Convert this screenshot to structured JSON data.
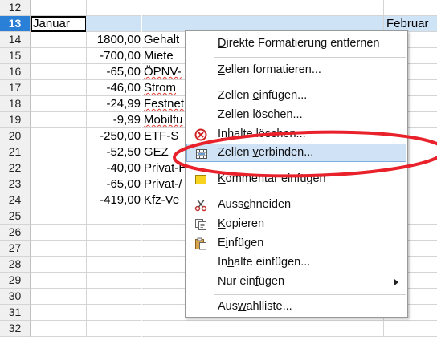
{
  "sheet": {
    "rows": [
      {
        "num": "12",
        "a": "",
        "b": "",
        "c": "",
        "d": ""
      },
      {
        "num": "13",
        "a": "Januar",
        "b": "",
        "c": "",
        "d": "Februar"
      },
      {
        "num": "14",
        "a": "",
        "b": "1800,00",
        "c": "Gehalt",
        "d": ""
      },
      {
        "num": "15",
        "a": "",
        "b": "-700,00",
        "c": "Miete",
        "d": ""
      },
      {
        "num": "16",
        "a": "",
        "b": "-65,00",
        "c": "ÖPNV-",
        "d": ""
      },
      {
        "num": "17",
        "a": "",
        "b": "-46,00",
        "c": "Strom",
        "d": ""
      },
      {
        "num": "18",
        "a": "",
        "b": "-24,99",
        "c": "Festnet",
        "d": ""
      },
      {
        "num": "19",
        "a": "",
        "b": "-9,99",
        "c": "Mobilfu",
        "d": ""
      },
      {
        "num": "20",
        "a": "",
        "b": "-250,00",
        "c": "ETF-S",
        "d": ""
      },
      {
        "num": "21",
        "a": "",
        "b": "-52,50",
        "c": "GEZ",
        "d": ""
      },
      {
        "num": "22",
        "a": "",
        "b": "-40,00",
        "c": "Privat-H",
        "d": ""
      },
      {
        "num": "23",
        "a": "",
        "b": "-65,00",
        "c": "Privat-/",
        "d": ""
      },
      {
        "num": "24",
        "a": "",
        "b": "-419,00",
        "c": "Kfz-Ve",
        "d": ""
      },
      {
        "num": "25",
        "a": "",
        "b": "",
        "c": "",
        "d": ""
      },
      {
        "num": "26",
        "a": "",
        "b": "",
        "c": "",
        "d": ""
      },
      {
        "num": "27",
        "a": "",
        "b": "",
        "c": "",
        "d": ""
      },
      {
        "num": "28",
        "a": "",
        "b": "",
        "c": "",
        "d": ""
      },
      {
        "num": "29",
        "a": "",
        "b": "",
        "c": "",
        "d": ""
      },
      {
        "num": "30",
        "a": "",
        "b": "",
        "c": "",
        "d": ""
      },
      {
        "num": "31",
        "a": "",
        "b": "",
        "c": "",
        "d": ""
      },
      {
        "num": "32",
        "a": "",
        "b": "",
        "c": "",
        "d": ""
      }
    ],
    "selected_row": "13"
  },
  "menu": {
    "remove_formatting": {
      "pre": "",
      "acc": "D",
      "post": "irekte Formatierung entfernen"
    },
    "format_cells": {
      "pre": "",
      "acc": "Z",
      "post": "ellen formatieren..."
    },
    "insert_cells": {
      "pre": "Zellen ",
      "acc": "e",
      "post": "infügen..."
    },
    "delete_cells": {
      "pre": "Zellen ",
      "acc": "l",
      "post": "öschen..."
    },
    "delete_contents": {
      "pre": "I",
      "acc": "n",
      "post": "halte löschen..."
    },
    "merge_cells": {
      "pre": "Zellen ",
      "acc": "v",
      "post": "erbinden..."
    },
    "insert_comment": {
      "pre": "",
      "acc": "K",
      "post": "ommentar einfügen"
    },
    "cut": {
      "pre": "Auss",
      "acc": "c",
      "post": "hneiden"
    },
    "copy": {
      "pre": "",
      "acc": "K",
      "post": "opieren"
    },
    "paste": {
      "pre": "E",
      "acc": "i",
      "post": "nfügen"
    },
    "paste_special": {
      "pre": "In",
      "acc": "h",
      "post": "alte einfügen..."
    },
    "paste_only": {
      "pre": "Nur ein",
      "acc": "f",
      "post": "ügen"
    },
    "selection_list": {
      "pre": "Aus",
      "acc": "w",
      "post": "ahlliste..."
    }
  },
  "icons": {
    "delete_contents": "clear-contents-icon",
    "merge_cells": "merge-cells-icon",
    "insert_comment": "comment-icon",
    "cut": "scissors-icon",
    "copy": "copy-icon",
    "paste": "clipboard-icon",
    "submenu": "chevron-right-icon"
  },
  "colors": {
    "selection_header": "#2a7fd6",
    "selection_row": "#cfe3f7",
    "menu_highlight": "#cfe2f6",
    "annotation": "#e8212b"
  }
}
